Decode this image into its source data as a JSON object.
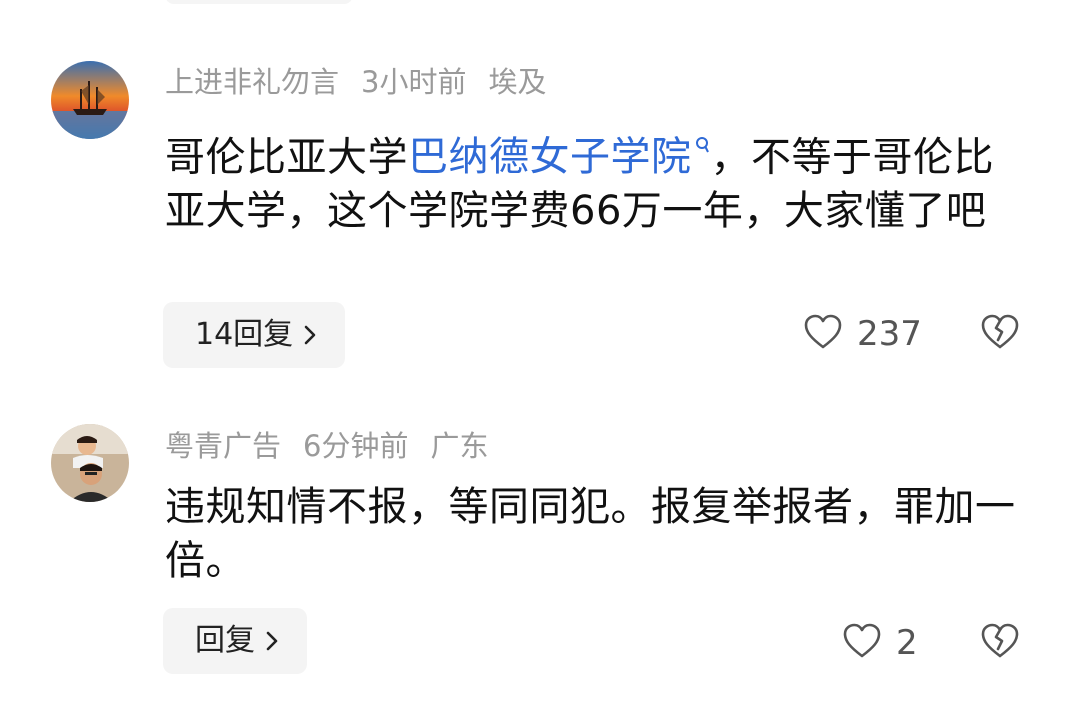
{
  "comments": [
    {
      "username": "上进非礼勿言",
      "time": "3小时前",
      "location": "埃及",
      "text_before": "哥伦比亚大学",
      "link_text": "巴纳德女子学院",
      "text_after": "，不等于哥伦比亚大学，这个学院学费66万一年，大家懂了吧",
      "reply_label": "14回复",
      "like_count": "237"
    },
    {
      "username": "粤青广告",
      "time": "6分钟前",
      "location": "广东",
      "text": "违规知情不报，等同同犯。报复举报者，罪加一倍。",
      "reply_label": "回复",
      "like_count": "2"
    }
  ],
  "colors": {
    "link": "#2f6ad6",
    "meta": "#9a9a9a",
    "button_bg": "#f4f4f4"
  }
}
